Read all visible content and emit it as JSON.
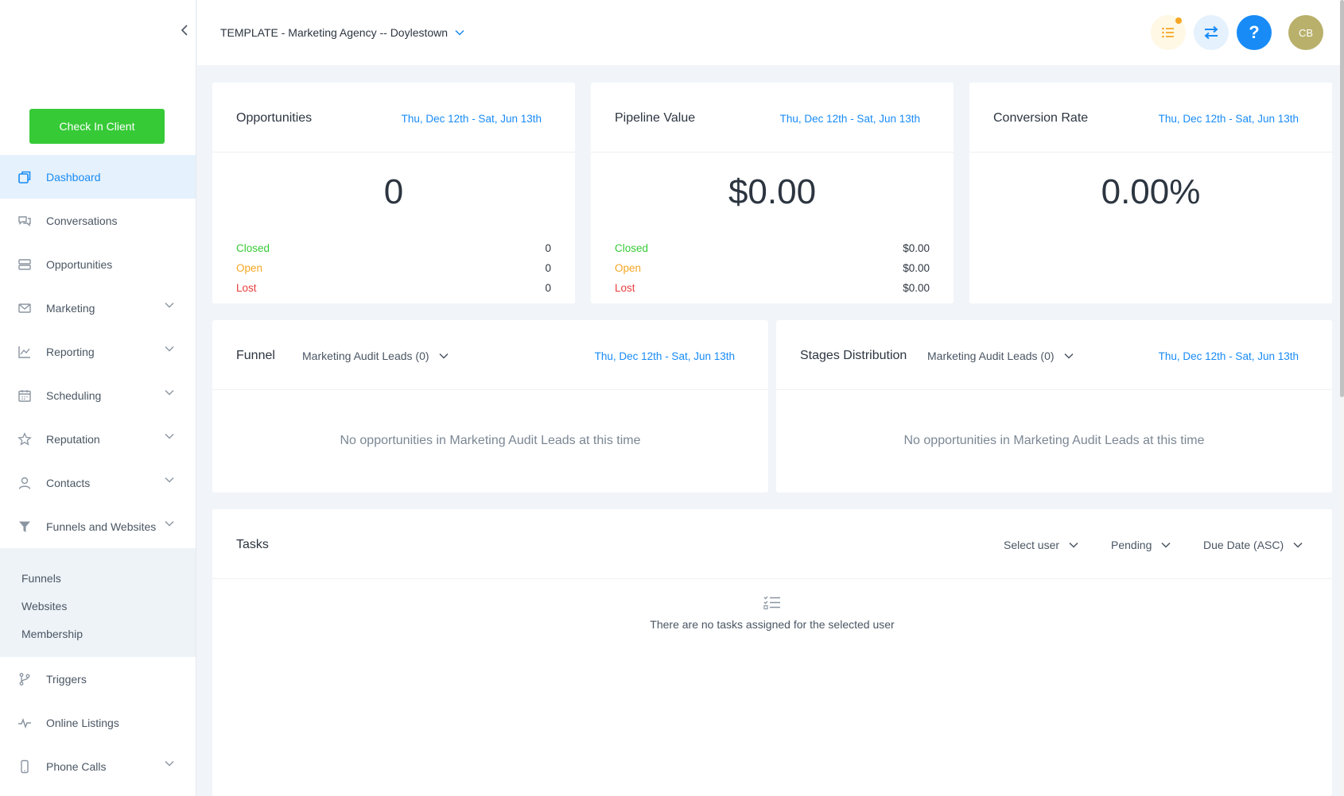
{
  "sidebar": {
    "check_in_label": "Check In Client",
    "items": [
      {
        "label": "Dashboard",
        "icon": "dashboard-icon",
        "active": true,
        "has_chevron": false
      },
      {
        "label": "Conversations",
        "icon": "chat-icon",
        "active": false,
        "has_chevron": false
      },
      {
        "label": "Opportunities",
        "icon": "pipeline-icon",
        "active": false,
        "has_chevron": false
      },
      {
        "label": "Marketing",
        "icon": "mail-icon",
        "active": false,
        "has_chevron": true
      },
      {
        "label": "Reporting",
        "icon": "chart-icon",
        "active": false,
        "has_chevron": true
      },
      {
        "label": "Scheduling",
        "icon": "calendar-icon",
        "active": false,
        "has_chevron": true
      },
      {
        "label": "Reputation",
        "icon": "star-icon",
        "active": false,
        "has_chevron": true
      },
      {
        "label": "Contacts",
        "icon": "user-icon",
        "active": false,
        "has_chevron": true
      },
      {
        "label": "Funnels and Websites",
        "icon": "filter-icon",
        "active": false,
        "has_chevron": true
      }
    ],
    "subitems": [
      "Funnels",
      "Websites",
      "Membership"
    ],
    "items_after": [
      {
        "label": "Triggers",
        "icon": "branch-icon",
        "has_chevron": false
      },
      {
        "label": "Online Listings",
        "icon": "pulse-icon",
        "has_chevron": false
      },
      {
        "label": "Phone Calls",
        "icon": "phone-icon",
        "has_chevron": true
      }
    ]
  },
  "header": {
    "location": "TEMPLATE - Marketing Agency -- Doylestown",
    "avatar_initials": "CB",
    "help_label": "?"
  },
  "cards": {
    "opportunities": {
      "title": "Opportunities",
      "date": "Thu, Dec 12th - Sat, Jun 13th",
      "value": "0",
      "closed_label": "Closed",
      "closed_value": "0",
      "open_label": "Open",
      "open_value": "0",
      "lost_label": "Lost",
      "lost_value": "0"
    },
    "pipeline": {
      "title": "Pipeline Value",
      "date": "Thu, Dec 12th - Sat, Jun 13th",
      "value": "$0.00",
      "closed_label": "Closed",
      "closed_value": "$0.00",
      "open_label": "Open",
      "open_value": "$0.00",
      "lost_label": "Lost",
      "lost_value": "$0.00"
    },
    "conversion": {
      "title": "Conversion Rate",
      "date": "Thu, Dec 12th - Sat, Jun 13th",
      "value": "0.00%"
    },
    "funnel": {
      "title": "Funnel",
      "pipeline": "Marketing Audit Leads (0)",
      "date": "Thu, Dec 12th - Sat, Jun 13th",
      "empty": "No opportunities in Marketing Audit Leads at this time"
    },
    "stages": {
      "title": "Stages Distribution",
      "pipeline": "Marketing Audit Leads (0)",
      "date": "Thu, Dec 12th - Sat, Jun 13th",
      "empty": "No opportunities in Marketing Audit Leads at this time"
    },
    "tasks": {
      "title": "Tasks",
      "user_filter": "Select user",
      "status_filter": "Pending",
      "sort_filter": "Due Date (ASC)",
      "empty": "There are no tasks assigned for the selected user"
    }
  },
  "colors": {
    "accent": "#188bf6",
    "check_in": "#37ca37",
    "closed": "#37ca37",
    "open": "#f5a623",
    "lost": "#e93d3d"
  }
}
